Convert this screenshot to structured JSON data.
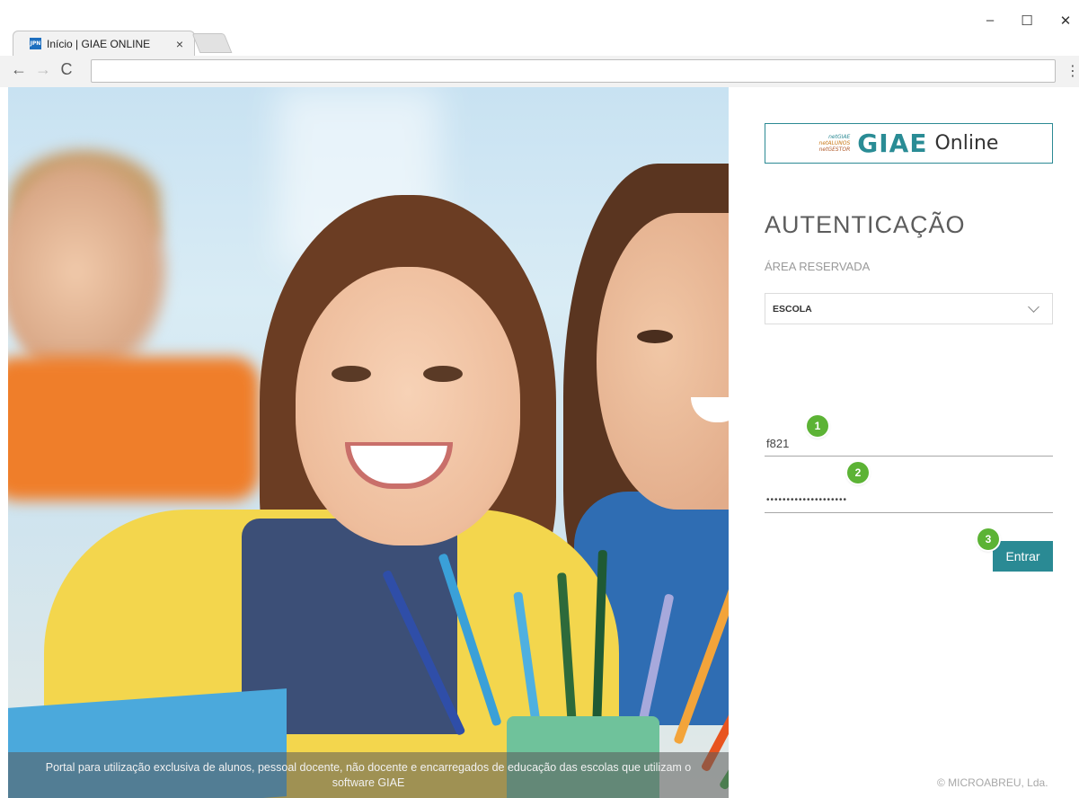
{
  "browser": {
    "tab_title": "Início | GIAE ONLINE",
    "favicon_text": "JPN",
    "tab_close": "×",
    "address": "",
    "win_minimize": "–",
    "win_maximize": "☐",
    "win_close": "✕",
    "back_icon": "←",
    "forward_icon": "→",
    "reload_icon": "C",
    "menu_icon": "⋮"
  },
  "logo": {
    "small_lines": [
      "netGIAE",
      "netALUNOS",
      "netGESTOR"
    ],
    "brand": "GIAE",
    "suffix": "Online"
  },
  "login": {
    "title": "AUTENTICAÇÃO",
    "subtitle": "ÁREA RESERVADA",
    "school_select": "ESCOLA",
    "username_value": "f821",
    "password_value": "••••••••••••••••••••",
    "submit_label": "Entrar"
  },
  "badges": [
    "1",
    "2",
    "3"
  ],
  "footer": {
    "text": "Portal para utilização exclusiva de alunos, pessoal docente, não docente e encarregados de educação das escolas que utilizam o software GIAE",
    "copyright": "© MICROABREU, Lda."
  },
  "colors": {
    "accent": "#2a8a94",
    "badge": "#5cb335"
  }
}
